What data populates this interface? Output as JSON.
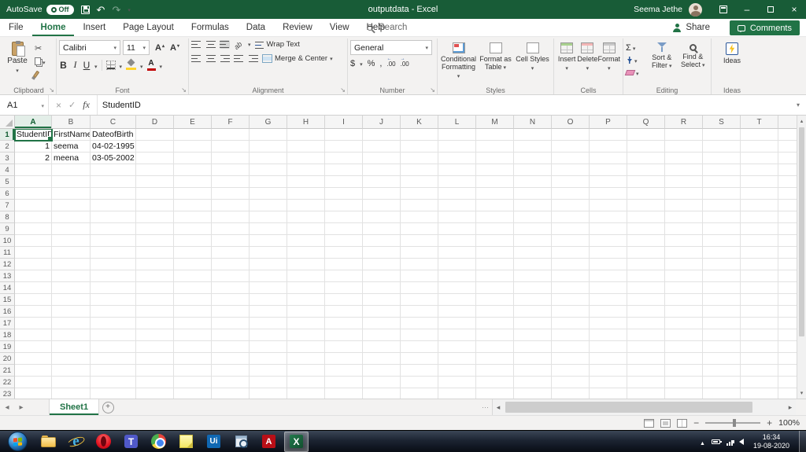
{
  "titlebar": {
    "autosave_label": "AutoSave",
    "autosave_state": "Off",
    "title": "outputdata - Excel",
    "user_name": "Seema Jethe"
  },
  "menubar": {
    "tabs": [
      {
        "label": "File",
        "active": false
      },
      {
        "label": "Home",
        "active": true
      },
      {
        "label": "Insert",
        "active": false
      },
      {
        "label": "Page Layout",
        "active": false
      },
      {
        "label": "Formulas",
        "active": false
      },
      {
        "label": "Data",
        "active": false
      },
      {
        "label": "Review",
        "active": false
      },
      {
        "label": "View",
        "active": false
      },
      {
        "label": "Help",
        "active": false
      }
    ],
    "search_label": "Search",
    "share_label": "Share",
    "comments_label": "Comments"
  },
  "ribbon": {
    "clipboard": {
      "paste": "Paste",
      "group_label": "Clipboard"
    },
    "font": {
      "family": "Calibri",
      "size": "11",
      "group_label": "Font"
    },
    "alignment": {
      "wrap_text": "Wrap Text",
      "merge_center": "Merge & Center",
      "group_label": "Alignment"
    },
    "number": {
      "format": "General",
      "group_label": "Number"
    },
    "styles": {
      "conditional_formatting": "Conditional Formatting",
      "format_as_table": "Format as Table",
      "cell_styles": "Cell Styles",
      "group_label": "Styles"
    },
    "cells": {
      "insert": "Insert",
      "delete": "Delete",
      "format": "Format",
      "group_label": "Cells"
    },
    "editing": {
      "sort_filter": "Sort & Filter",
      "find_select": "Find & Select",
      "group_label": "Editing"
    },
    "ideas": {
      "ideas": "Ideas",
      "group_label": "Ideas"
    }
  },
  "formula_bar": {
    "name_box": "A1",
    "content": "StudentID"
  },
  "grid": {
    "selected_cell": "A1",
    "columns": [
      "A",
      "B",
      "C",
      "D",
      "E",
      "F",
      "G",
      "H",
      "I",
      "J",
      "K",
      "L",
      "M",
      "N",
      "O",
      "P",
      "Q",
      "R",
      "S",
      "T"
    ],
    "row_count": 23,
    "cells": [
      {
        "ref": "A1",
        "value": "StudentID",
        "align": "left"
      },
      {
        "ref": "B1",
        "value": "FirstName",
        "align": "left"
      },
      {
        "ref": "C1",
        "value": "DateofBirth",
        "align": "left"
      },
      {
        "ref": "A2",
        "value": "1",
        "align": "right"
      },
      {
        "ref": "B2",
        "value": "seema",
        "align": "left"
      },
      {
        "ref": "C2",
        "value": "04-02-1995",
        "align": "right"
      },
      {
        "ref": "A3",
        "value": "2",
        "align": "right"
      },
      {
        "ref": "B3",
        "value": "meena",
        "align": "left"
      },
      {
        "ref": "C3",
        "value": "03-05-2002",
        "align": "right"
      }
    ]
  },
  "sheet_bar": {
    "tabs": [
      {
        "label": "Sheet1",
        "active": true
      }
    ]
  },
  "status_bar": {
    "zoom_level": "100%"
  },
  "taskbar": {
    "clock_time": "16:34",
    "clock_date": "19-08-2020",
    "apps": [
      {
        "name": "file-explorer",
        "active": false
      },
      {
        "name": "internet-explorer",
        "active": false
      },
      {
        "name": "opera",
        "active": false
      },
      {
        "name": "microsoft-teams",
        "active": false
      },
      {
        "name": "google-chrome",
        "active": false
      },
      {
        "name": "sticky-notes",
        "active": false
      },
      {
        "name": "uipath",
        "active": false
      },
      {
        "name": "ui-explorer",
        "active": false
      },
      {
        "name": "adobe-acrobat",
        "active": false
      },
      {
        "name": "excel",
        "active": true
      }
    ]
  },
  "glyphs": {
    "undo": "↶",
    "redo": "↷",
    "minimize": "–",
    "close": "×",
    "cut": "✂",
    "bold": "B",
    "italic": "I",
    "underline": "U",
    "font_letter": "A",
    "sigma": "Σ",
    "currency": "$",
    "percent": "%",
    "comma": ",",
    "decimal": ".00",
    "orientation": "ab",
    "fx": "fx",
    "cancel": "×",
    "enter": "✓",
    "prev": "◂",
    "next": "▸",
    "zoom_out": "−",
    "zoom_in": "+",
    "ellipsis": "⋯"
  },
  "colors": {
    "excel_green": "#217346",
    "titlebar_green": "#185c37"
  }
}
